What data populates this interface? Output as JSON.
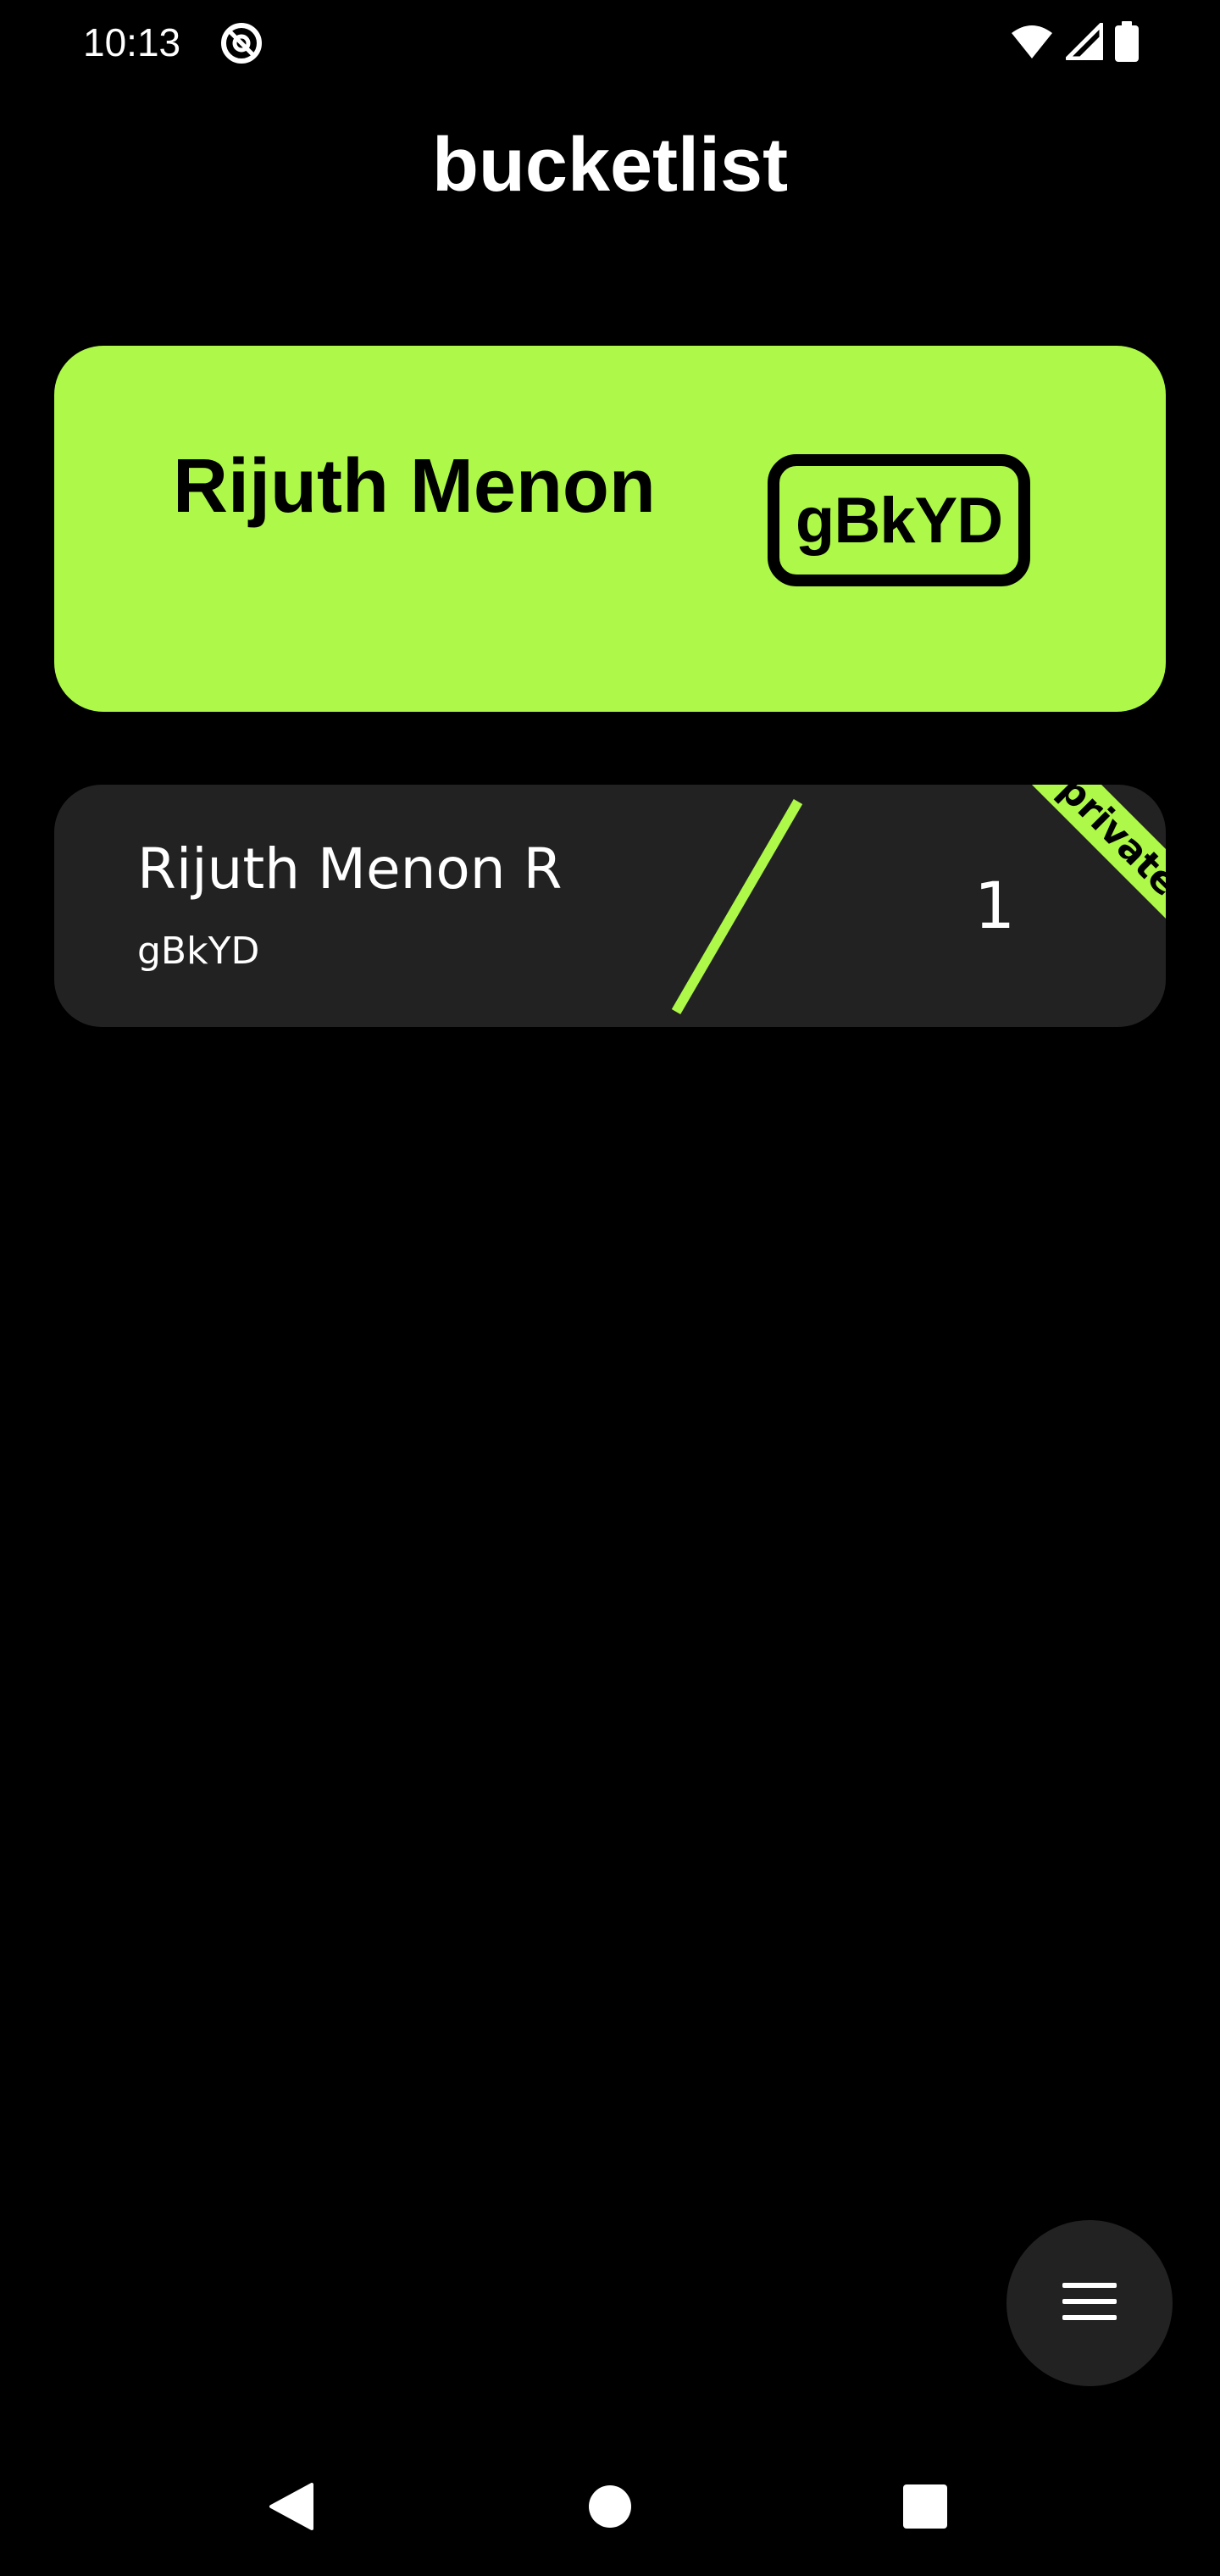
{
  "status_bar": {
    "time": "10:13",
    "app_icon": "at-sign-icon",
    "icons": [
      "wifi-icon",
      "cellular-signal-icon",
      "battery-icon"
    ]
  },
  "app": {
    "title": "bucketlist"
  },
  "profile": {
    "name": "Rijuth Menon",
    "code": "gBkYD"
  },
  "lists": [
    {
      "title": "Rijuth Menon R",
      "code": "gBkYD",
      "count": "1",
      "visibility": "private"
    }
  ],
  "fab": {
    "icon": "menu-icon"
  },
  "nav": {
    "icons": [
      "back-icon",
      "home-icon",
      "recents-icon"
    ]
  },
  "colors": {
    "accent": "#adf848",
    "background": "#000000",
    "card": "#222222",
    "text": "#ffffff"
  }
}
